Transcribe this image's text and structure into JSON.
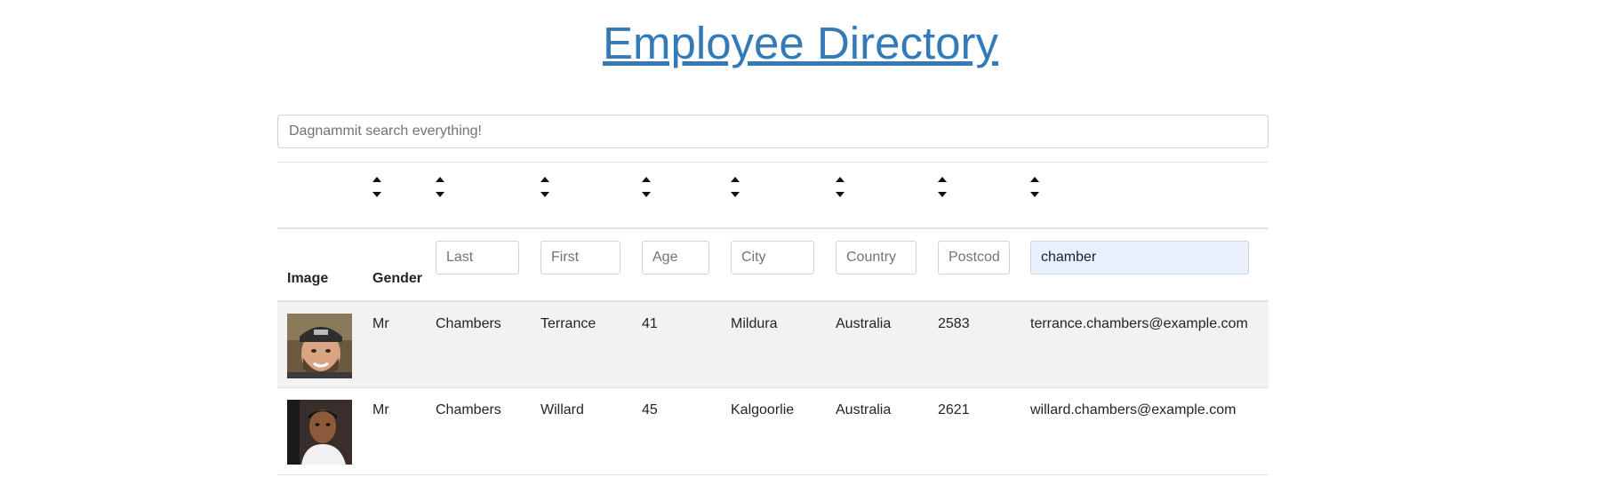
{
  "page": {
    "title": "Employee Directory",
    "search_placeholder": "Dagnammit search everything!"
  },
  "table": {
    "headers": {
      "image": "Image",
      "gender": "Gender"
    },
    "filters": {
      "last_placeholder": "Last",
      "first_placeholder": "First",
      "age_placeholder": "Age",
      "city_placeholder": "City",
      "country_placeholder": "Country",
      "postcode_placeholder": "Postcode",
      "email_value": "chamber"
    },
    "rows": [
      {
        "gender": "Mr",
        "last": "Chambers",
        "first": "Terrance",
        "age": "41",
        "city": "Mildura",
        "country": "Australia",
        "postcode": "2583",
        "email": "terrance.chambers@example.com"
      },
      {
        "gender": "Mr",
        "last": "Chambers",
        "first": "Willard",
        "age": "45",
        "city": "Kalgoorlie",
        "country": "Australia",
        "postcode": "2621",
        "email": "willard.chambers@example.com"
      }
    ]
  }
}
